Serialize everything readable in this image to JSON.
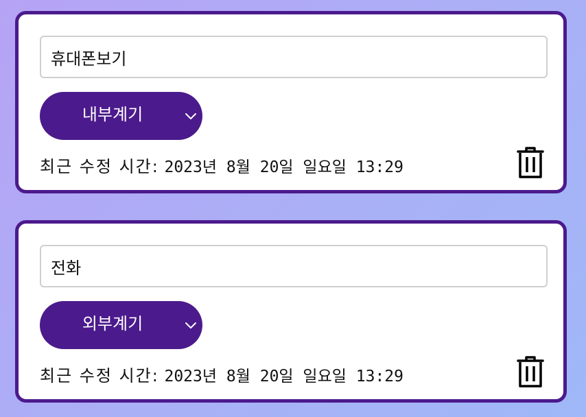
{
  "cards": [
    {
      "title": "휴대폰보기",
      "category": "내부계기",
      "modified_label": "최근 수정 시간:",
      "modified_value": "2023년 8월 20일 일요일 13:29"
    },
    {
      "title": "전화",
      "category": "외부계기",
      "modified_label": "최근 수정 시간:",
      "modified_value": "2023년 8월 20일 일요일 13:29"
    }
  ],
  "icons": {
    "dropdown": "chevron-down-icon",
    "delete": "trash-icon"
  },
  "colors": {
    "accent": "#4b1a8c",
    "card_background": "#ffffff",
    "input_border": "#cfcfcf"
  }
}
